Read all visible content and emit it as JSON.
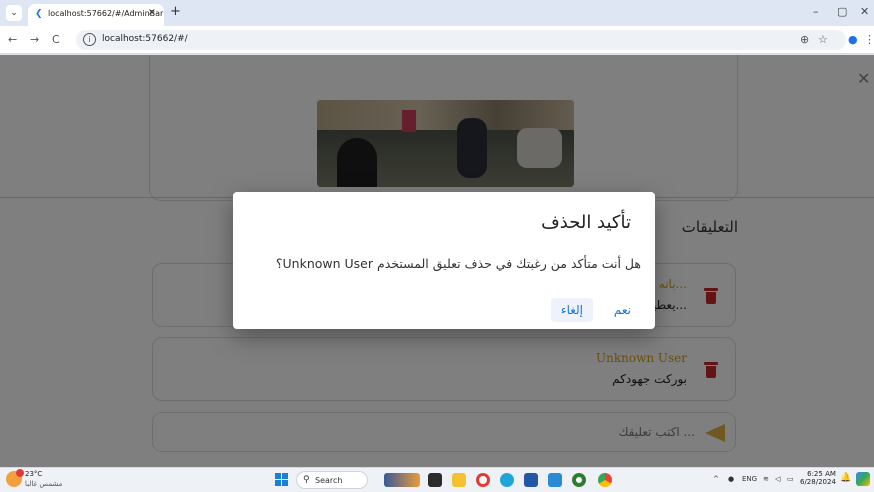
{
  "browser": {
    "tab_menu_icon": "chevron-down",
    "tab_title": "localhost:57662/#/AdminBar",
    "tab_close": "×",
    "new_tab": "+",
    "url": "localhost:57662/#/",
    "win_minimize": "–",
    "win_restore": "▢",
    "win_close": "✕",
    "back": "←",
    "forward": "→",
    "reload": "C",
    "zoom_icon": "⊕",
    "bookmark_icon": "☆",
    "menu_icon": "⋮"
  },
  "page": {
    "close_icon": "✕",
    "comments_tab_label": "التعليقات",
    "comments": [
      {
        "author": "بانه ج...",
        "body": "يعطيكم ا..."
      },
      {
        "author": "Unknown User",
        "body": "بوركت جهودكم"
      }
    ],
    "compose_placeholder": "اكتب تعليقك ..."
  },
  "dialog": {
    "title": "تأكيد الحذف",
    "message": "؟Unknown User هل أنت متأكد من رغبتك في حذف تعليق المستخدم",
    "yes_label": "نعم",
    "cancel_label": "إلغاء"
  },
  "taskbar": {
    "weather_temp": "23°C",
    "weather_desc": "مشمس غالبا",
    "search_label": "Search",
    "lang": "ENG",
    "time": "6:25 AM",
    "date": "6/28/2024"
  },
  "colors": {
    "accent_blue": "#1976d2",
    "author_gold": "#d4a017",
    "delete_red": "#c62828",
    "send_yellow": "#e0b341"
  }
}
